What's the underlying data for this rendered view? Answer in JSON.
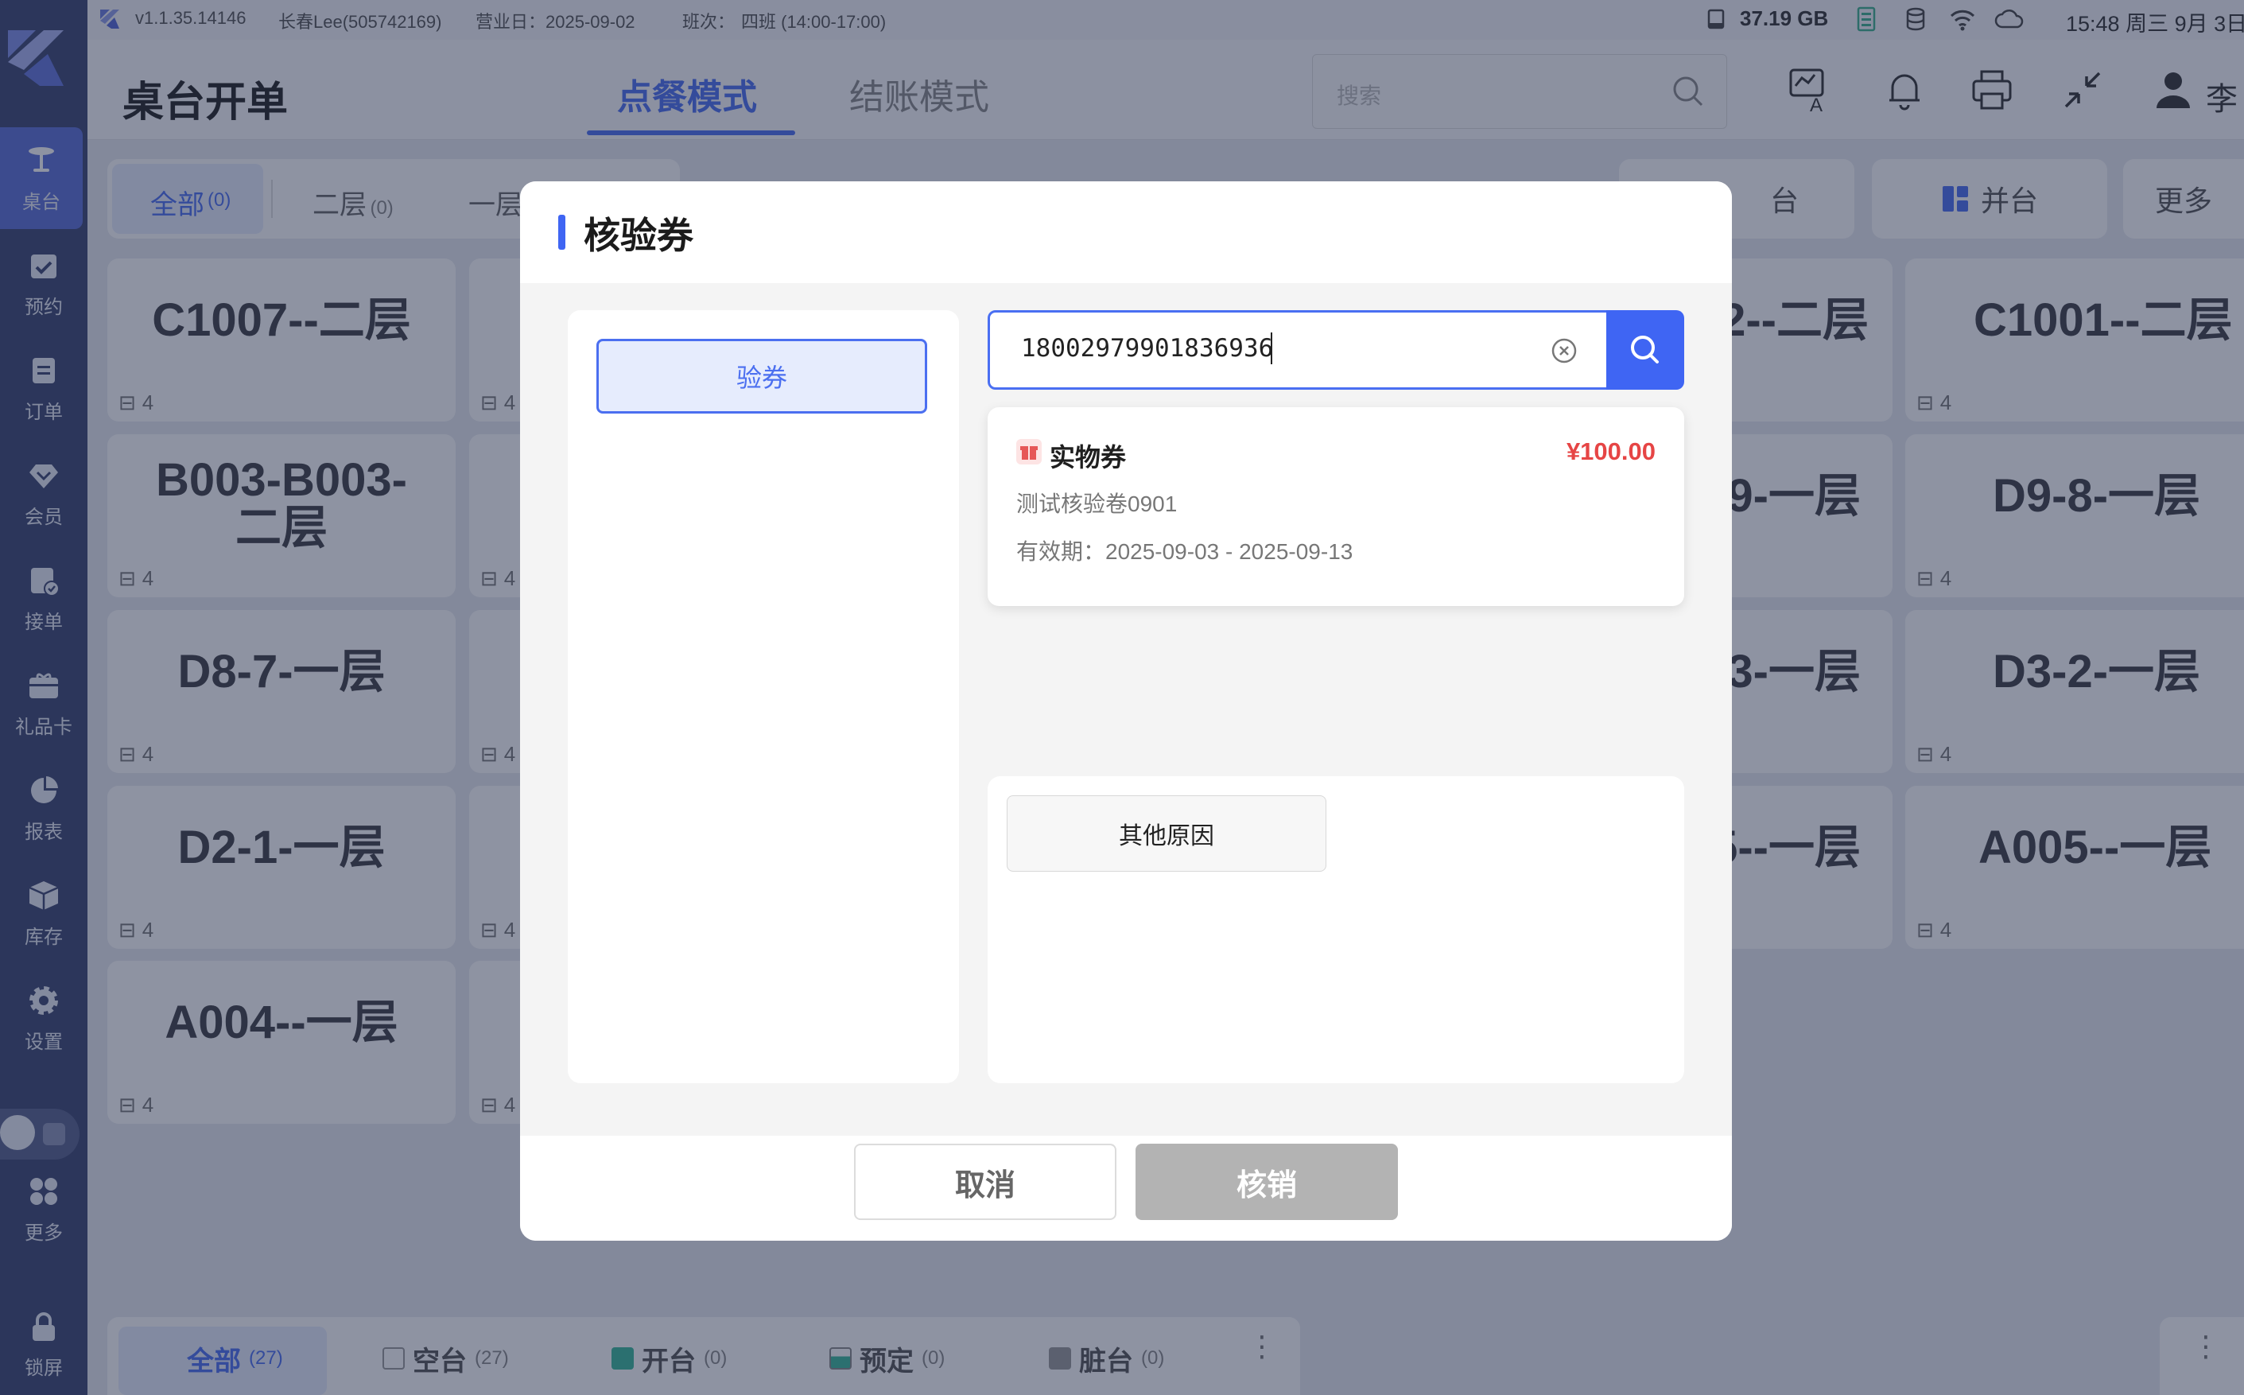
{
  "status_bar": {
    "version": "v1.1.35.14146",
    "user": "长春Lee(505742169)",
    "business_day": "营业日：2025-09-02",
    "shift_label": "班次：",
    "shift_value": "四班 (14:00-17:00)",
    "storage": "37.19 GB",
    "datetime": "15:48 周三 9月 3日"
  },
  "sidebar": {
    "items": [
      {
        "label": "桌台",
        "icon": "table-icon"
      },
      {
        "label": "预约",
        "icon": "calendar-check-icon"
      },
      {
        "label": "订单",
        "icon": "order-icon"
      },
      {
        "label": "会员",
        "icon": "member-icon"
      },
      {
        "label": "接单",
        "icon": "accept-order-icon"
      },
      {
        "label": "礼品卡",
        "icon": "gift-card-icon"
      },
      {
        "label": "报表",
        "icon": "pie-chart-icon"
      },
      {
        "label": "库存",
        "icon": "box-icon"
      },
      {
        "label": "设置",
        "icon": "gear-icon"
      },
      {
        "label": "更多",
        "icon": "grid-icon"
      },
      {
        "label": "锁屏",
        "icon": "lock-icon"
      }
    ]
  },
  "header": {
    "title": "桌台开单",
    "tab_order": "点餐模式",
    "tab_checkout": "结账模式",
    "search_placeholder": "搜索",
    "user_initial": "李"
  },
  "floor_tabs": {
    "all": "全部",
    "all_count": "(0)",
    "second": "二层",
    "second_count": "(0)",
    "first": "一层"
  },
  "actions": {
    "open_partial": "台",
    "merge": "并台",
    "more": "更多"
  },
  "tables_left": [
    {
      "name": "C1007--二层",
      "seats": "4"
    },
    {
      "name": "B003-B003-二层",
      "seats": "4"
    },
    {
      "name": "D8-7-一层",
      "seats": "4"
    },
    {
      "name": "D2-1-一层",
      "seats": "4"
    },
    {
      "name": "A004--一层",
      "seats": "4"
    }
  ],
  "seats_col2": [
    "4",
    "4",
    "4",
    "4",
    "4"
  ],
  "tables_right_partial": [
    "2--二层",
    "9-一层",
    "3-一层",
    "5--一层"
  ],
  "tables_right": [
    {
      "name": "C1001--二层",
      "seats": "4"
    },
    {
      "name": "D9-8-一层",
      "seats": "4"
    },
    {
      "name": "D3-2-一层",
      "seats": "4"
    },
    {
      "name": "A005--一层",
      "seats": "4"
    }
  ],
  "bottom_bar": {
    "all": "全部",
    "all_count": "(27)",
    "empty": "空台",
    "empty_count": "(27)",
    "open": "开台",
    "open_count": "(0)",
    "reserved": "预定",
    "reserved_count": "(0)",
    "dirty": "脏台",
    "dirty_count": "(0)"
  },
  "modal": {
    "title": "核验券",
    "verify_tab": "验券",
    "code_value": "18002979901836936",
    "coupon": {
      "type": "实物券",
      "price": "¥100.00",
      "name": "测试核验卷0901",
      "validity": "有效期：2025-09-03 - 2025-09-13"
    },
    "reason": "其他原因",
    "cancel": "取消",
    "confirm": "核销"
  },
  "colors": {
    "primary": "#3f65f3",
    "sidebar": "#3a4470",
    "price": "#e64545",
    "disabled": "#b3b3b3"
  }
}
